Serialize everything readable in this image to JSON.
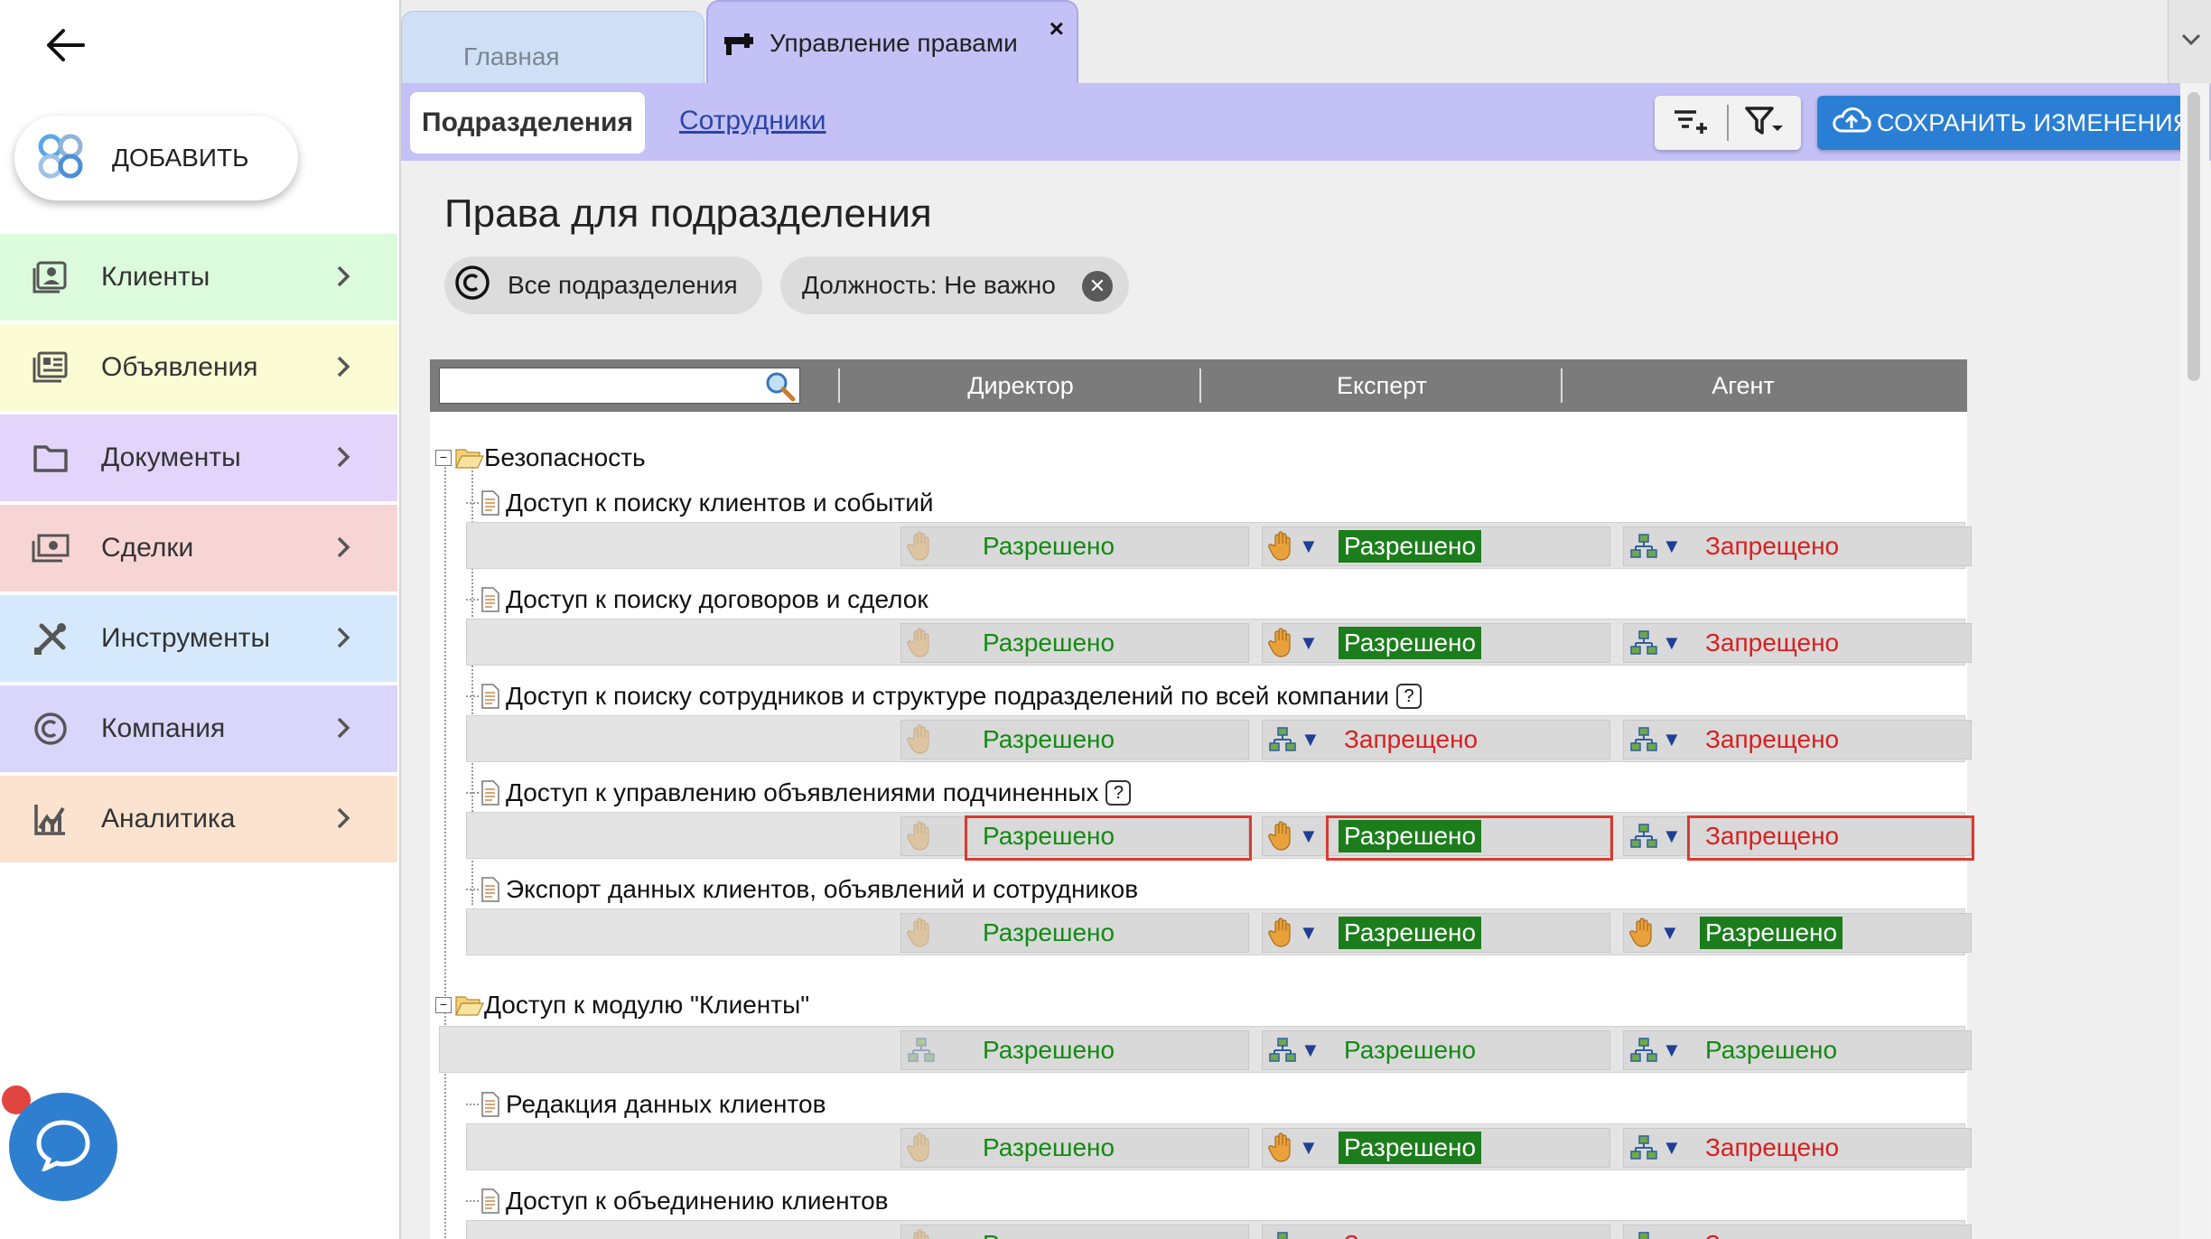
{
  "sidebar": {
    "add_label": "ДОБАВИТЬ",
    "items": [
      {
        "label": "Клиенты",
        "icon": "contacts-icon",
        "color": "#dcfadc"
      },
      {
        "label": "Объявления",
        "icon": "listings-icon",
        "color": "#fbfbd4"
      },
      {
        "label": "Документы",
        "icon": "folder-icon",
        "color": "#e3d4fb"
      },
      {
        "label": "Сделки",
        "icon": "money-icon",
        "color": "#f8d5d5"
      },
      {
        "label": "Инструменты",
        "icon": "tools-icon",
        "color": "#d6e9fc"
      },
      {
        "label": "Компания",
        "icon": "copyright-icon",
        "color": "#d8d6fb"
      },
      {
        "label": "Аналитика",
        "icon": "analytics-icon",
        "color": "#fbe3cf"
      }
    ]
  },
  "tabs": {
    "home": "Главная",
    "rights": "Управление правами",
    "close": "×"
  },
  "subbar": {
    "active": "Подразделения",
    "link": "Сотрудники",
    "save": "СОХРАНИТЬ ИЗМЕНЕНИЯ"
  },
  "content": {
    "title": "Права для подразделения",
    "chip_all": "Все подразделения",
    "chip_position": "Должность: Не важно"
  },
  "table": {
    "columns": [
      "Директор",
      "Експерт",
      "Агент"
    ],
    "groups": [
      {
        "label": "Безопасность"
      },
      {
        "label": "Доступ к модулю \"Клиенты\""
      }
    ],
    "rows": [
      {
        "label": "Доступ к поиску клиентов и событий",
        "help": false,
        "cells": [
          {
            "icon": "hand",
            "value": "Разрешено",
            "state": "ok",
            "highlight": false
          },
          {
            "icon": "hand",
            "value": "Разрешено",
            "state": "ok-hi",
            "highlight": false
          },
          {
            "icon": "tree",
            "value": "Запрещено",
            "state": "no",
            "highlight": false
          }
        ]
      },
      {
        "label": "Доступ к поиску договоров и сделок",
        "help": false,
        "cells": [
          {
            "icon": "hand",
            "value": "Разрешено",
            "state": "ok",
            "highlight": false
          },
          {
            "icon": "hand",
            "value": "Разрешено",
            "state": "ok-hi",
            "highlight": false
          },
          {
            "icon": "tree",
            "value": "Запрещено",
            "state": "no",
            "highlight": false
          }
        ]
      },
      {
        "label": "Доступ к поиску сотрудников и структуре подразделений по всей компании",
        "help": true,
        "cells": [
          {
            "icon": "hand",
            "value": "Разрешено",
            "state": "ok",
            "highlight": false
          },
          {
            "icon": "tree",
            "value": "Запрещено",
            "state": "no",
            "highlight": false
          },
          {
            "icon": "tree",
            "value": "Запрещено",
            "state": "no",
            "highlight": false
          }
        ]
      },
      {
        "label": "Доступ к управлению объявлениями подчиненных",
        "help": true,
        "cells": [
          {
            "icon": "hand",
            "value": "Разрешено",
            "state": "ok",
            "highlight": true
          },
          {
            "icon": "hand",
            "value": "Разрешено",
            "state": "ok-hi",
            "highlight": true
          },
          {
            "icon": "tree",
            "value": "Запрещено",
            "state": "no",
            "highlight": true
          }
        ]
      },
      {
        "label": "Экспорт данных клиентов, объявлений и сотрудников",
        "help": false,
        "cells": [
          {
            "icon": "hand",
            "value": "Разрешено",
            "state": "ok",
            "highlight": false
          },
          {
            "icon": "hand",
            "value": "Разрешено",
            "state": "ok-hi",
            "highlight": false
          },
          {
            "icon": "hand",
            "value": "Разрешено",
            "state": "ok-hi",
            "highlight": false
          }
        ]
      },
      {
        "label": "",
        "help": false,
        "cells": [
          {
            "icon": "tree",
            "value": "Разрешено",
            "state": "ok",
            "highlight": false
          },
          {
            "icon": "tree",
            "value": "Разрешено",
            "state": "ok",
            "highlight": false
          },
          {
            "icon": "tree",
            "value": "Разрешено",
            "state": "ok",
            "highlight": false
          }
        ]
      },
      {
        "label": "Редакция данных клиентов",
        "help": false,
        "cells": [
          {
            "icon": "hand",
            "value": "Разрешено",
            "state": "ok",
            "highlight": false
          },
          {
            "icon": "hand",
            "value": "Разрешено",
            "state": "ok-hi",
            "highlight": false
          },
          {
            "icon": "tree",
            "value": "Запрещено",
            "state": "no",
            "highlight": false
          }
        ]
      },
      {
        "label": "Доступ к объединению клиентов",
        "help": false,
        "cells": [
          {
            "icon": "hand",
            "value": "Разрешено",
            "state": "ok",
            "highlight": false
          },
          {
            "icon": "tree",
            "value": "Запрещено",
            "state": "no",
            "highlight": false
          },
          {
            "icon": "tree",
            "value": "Запрещено",
            "state": "no",
            "highlight": false
          }
        ]
      }
    ]
  }
}
